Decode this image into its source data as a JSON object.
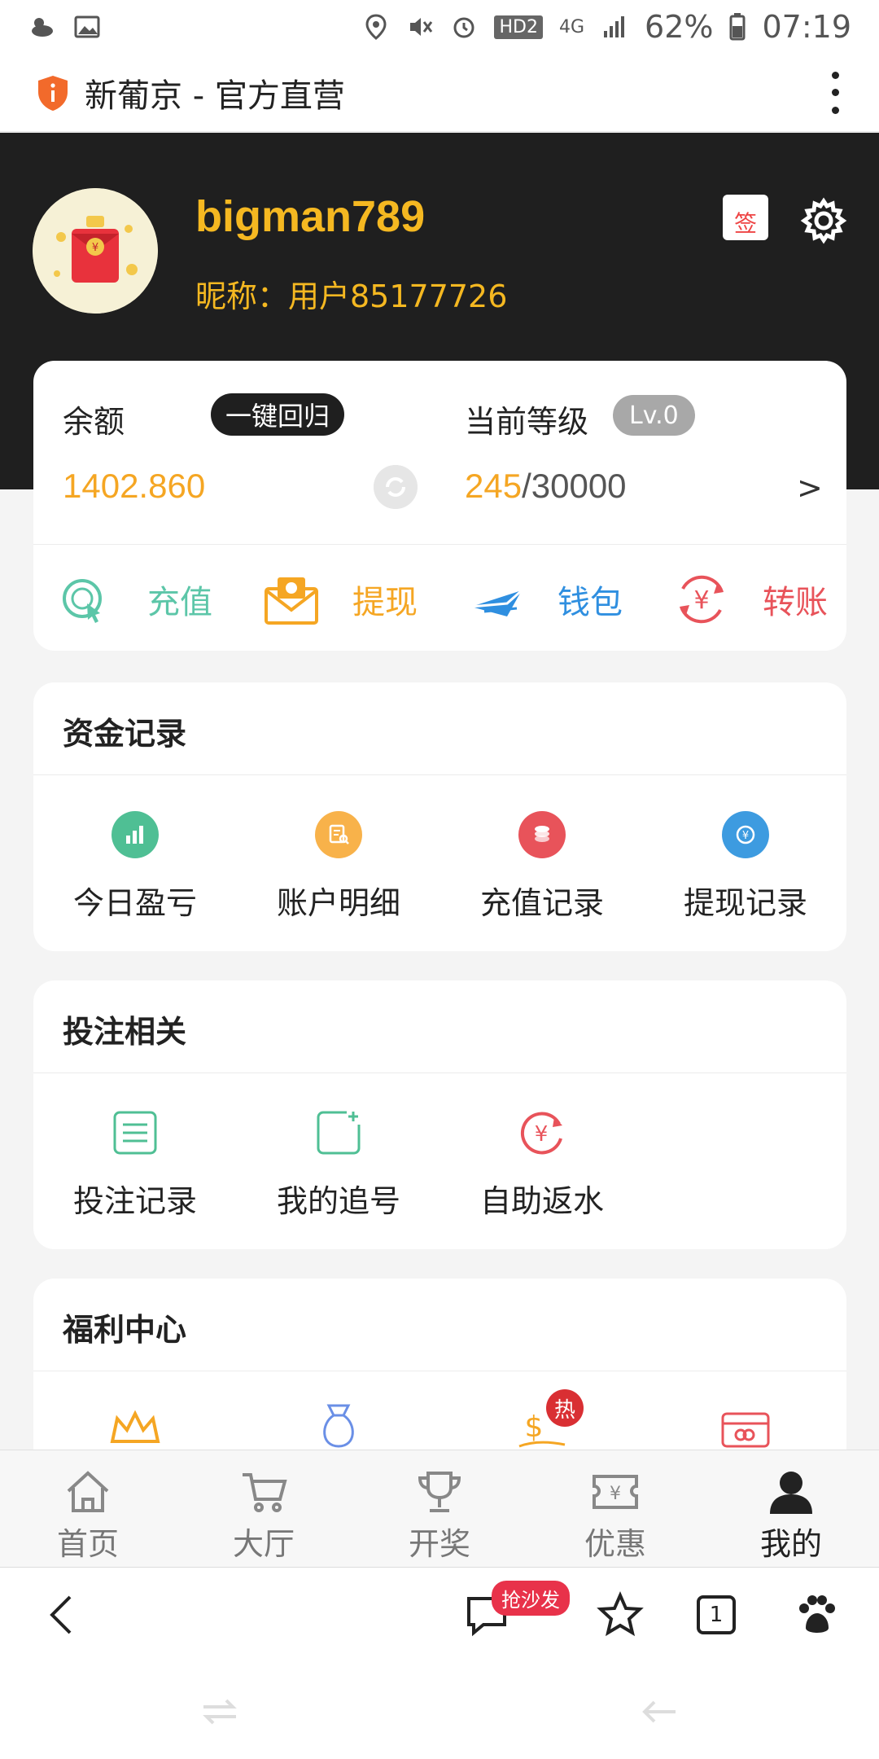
{
  "status_bar": {
    "battery": "62%",
    "time": "07:19",
    "network": "4G",
    "hd": "HD2"
  },
  "browser": {
    "title": "新葡京 - 官方直营",
    "bottom_badge": "抢沙发",
    "tab_count": "1"
  },
  "profile": {
    "username": "bigman789",
    "nickname": "昵称：用户85177726",
    "sign_label": "签"
  },
  "balance": {
    "label": "余额",
    "recall_button": "一键回归",
    "value": "1402.860",
    "level_label": "当前等级",
    "level_badge": "Lv.0",
    "level_current": "245",
    "level_total": "/30000",
    "arrow": ">"
  },
  "quick_actions": [
    {
      "label": "充值",
      "color": "#5cc6a8",
      "icon": "recharge-icon"
    },
    {
      "label": "提现",
      "color": "#f5a623",
      "icon": "withdraw-envelope-icon"
    },
    {
      "label": "钱包",
      "color": "#2f8fe0",
      "icon": "wallet-plane-icon"
    },
    {
      "label": "转账",
      "color": "#e8535a",
      "icon": "transfer-yen-icon"
    }
  ],
  "fund_records": {
    "title": "资金记录",
    "items": [
      {
        "label": "今日盈亏",
        "color": "#4fbf94",
        "icon": "bar-chart-icon"
      },
      {
        "label": "账户明细",
        "color": "#f8b24a",
        "icon": "document-search-icon"
      },
      {
        "label": "充值记录",
        "color": "#e8535a",
        "icon": "coins-icon"
      },
      {
        "label": "提现记录",
        "color": "#3d9be0",
        "icon": "yen-circle-icon"
      }
    ]
  },
  "betting": {
    "title": "投注相关",
    "items": [
      {
        "label": "投注记录",
        "color": "#4fbf94",
        "icon": "list-icon"
      },
      {
        "label": "我的追号",
        "color": "#4fbf94",
        "icon": "add-note-icon"
      },
      {
        "label": "自助返水",
        "color": "#e8535a",
        "icon": "yen-refresh-icon"
      }
    ]
  },
  "welfare": {
    "title": "福利中心",
    "hot_badge": "热",
    "icons": [
      "crown-icon",
      "money-bag-icon",
      "dollar-hand-icon",
      "vip-card-icon"
    ]
  },
  "tabs": [
    {
      "label": "首页",
      "icon": "home-icon"
    },
    {
      "label": "大厅",
      "icon": "cart-icon"
    },
    {
      "label": "开奖",
      "icon": "trophy-icon"
    },
    {
      "label": "优惠",
      "icon": "coupon-icon"
    },
    {
      "label": "我的",
      "icon": "user-icon"
    }
  ]
}
